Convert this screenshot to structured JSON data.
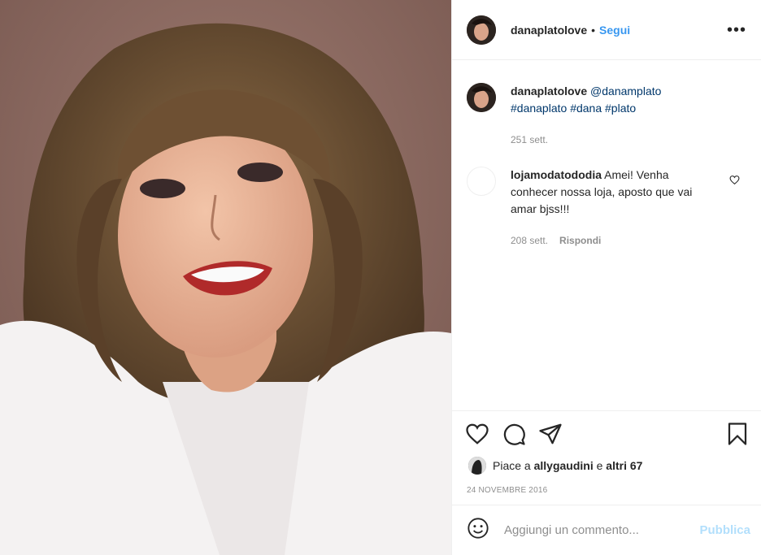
{
  "post": {
    "username": "danaplatolove",
    "separator": "•",
    "follow_label": "Segui",
    "more_label": "•••"
  },
  "caption": {
    "username": "danaplatolove",
    "mention": "@danamplato",
    "hashtags": [
      "#danaplato",
      "#dana",
      "#plato"
    ],
    "age": "251 sett."
  },
  "comment": {
    "username": "lojamodatododia",
    "text": "Amei! Venha conhecer nossa loja, aposto que vai amar bjss!!!",
    "age": "208 sett.",
    "reply_label": "Rispondi"
  },
  "likes": {
    "prefix": "Piace a ",
    "user": "allygaudini",
    "mid": " e ",
    "others": "altri 67"
  },
  "date": "24 NOVEMBRE 2016",
  "add_comment": {
    "placeholder": "Aggiungi un commento...",
    "publish_label": "Pubblica"
  },
  "colors": {
    "link": "#3897f0",
    "hashtag": "#00376b",
    "muted": "#8e8e8e",
    "publish_disabled": "#b2dffc",
    "backdrop": "#8e6c63"
  },
  "icons": [
    "more-icon",
    "heart-icon",
    "comment-icon",
    "share-icon",
    "bookmark-icon",
    "emoji-icon"
  ]
}
